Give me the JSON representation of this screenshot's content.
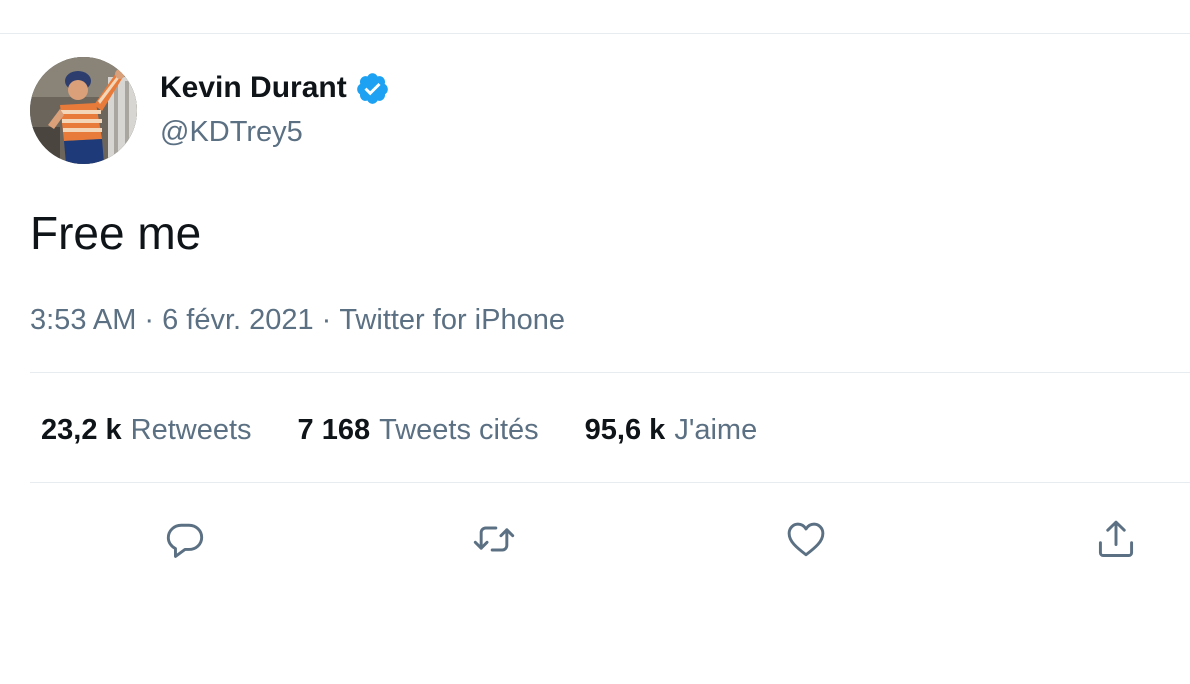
{
  "tweet": {
    "author": {
      "display_name": "Kevin Durant",
      "handle": "@KDTrey5",
      "verified": true,
      "avatar_icon": "user-avatar-photo"
    },
    "text": "Free me",
    "time": "3:53 AM",
    "date": "6 févr. 2021",
    "separator": "·",
    "source": "Twitter for iPhone"
  },
  "stats": {
    "retweets": {
      "count": "23,2 k",
      "label": "Retweets"
    },
    "quote_tweets": {
      "count": "7 168",
      "label": "Tweets cités"
    },
    "likes": {
      "count": "95,6 k",
      "label": "J'aime"
    }
  },
  "actions": [
    {
      "name": "reply",
      "icon": "reply-icon"
    },
    {
      "name": "retweet",
      "icon": "retweet-icon"
    },
    {
      "name": "like",
      "icon": "heart-icon"
    },
    {
      "name": "share",
      "icon": "share-icon"
    }
  ],
  "colors": {
    "text_primary": "#0f1419",
    "text_secondary": "#5b7083",
    "verified_blue": "#1da1f2",
    "divider": "#e6ecf0"
  }
}
